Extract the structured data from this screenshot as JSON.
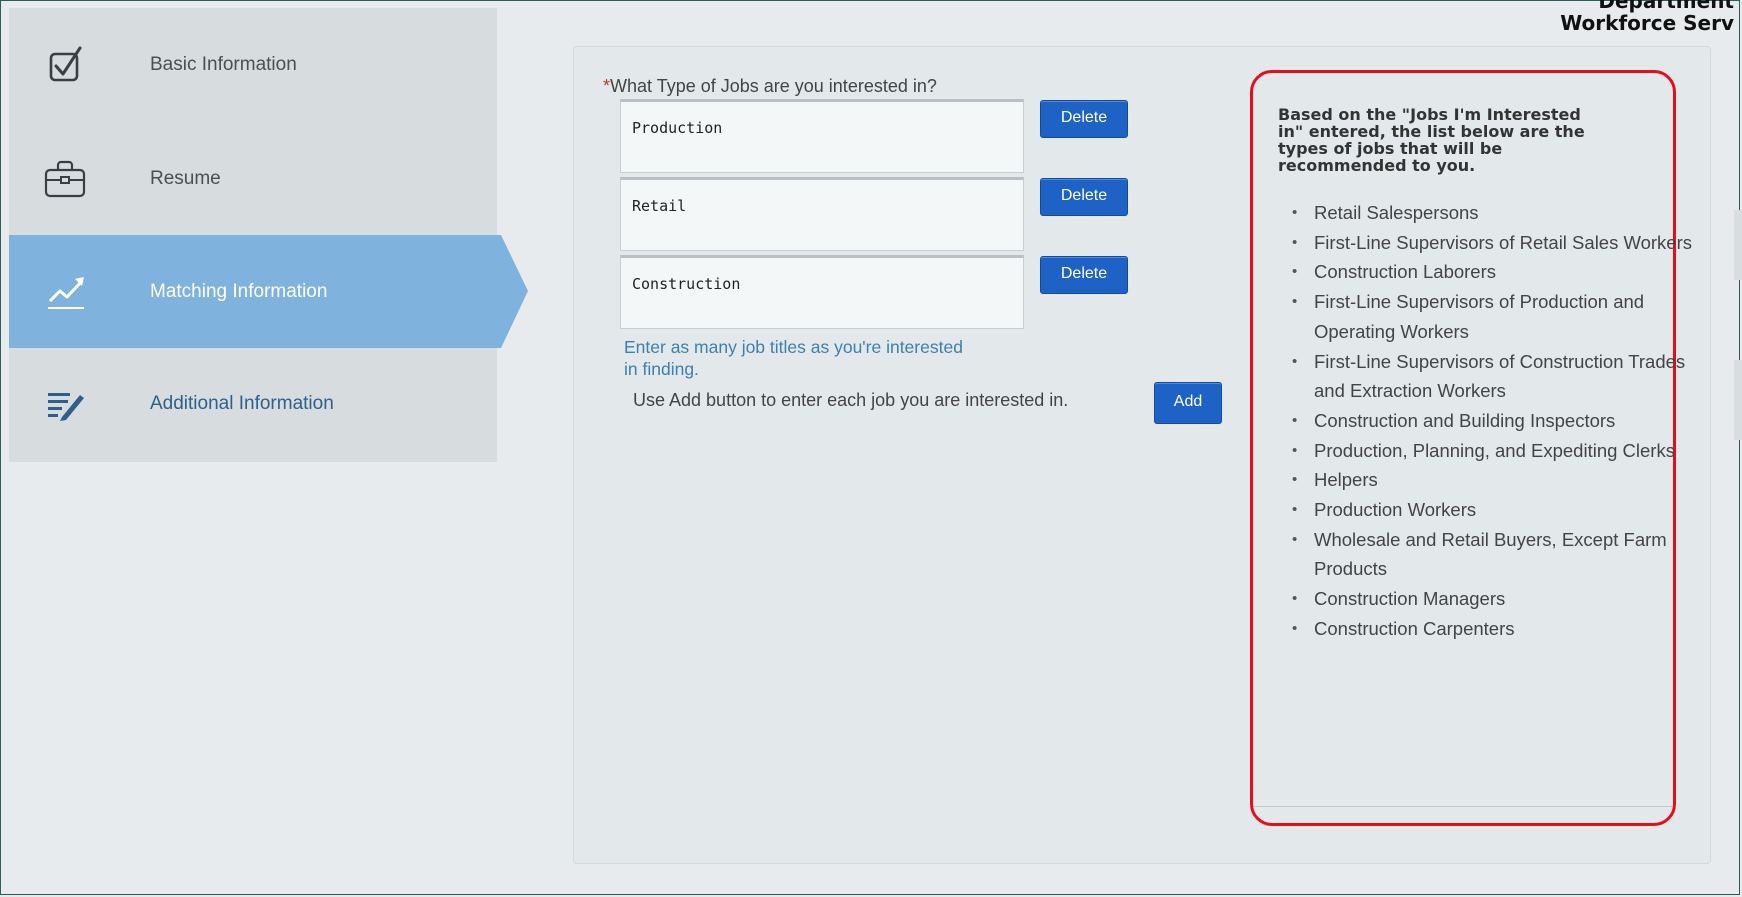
{
  "brand": {
    "line1": "Department",
    "line2": "Workforce Serv"
  },
  "sidebar": {
    "items": [
      {
        "label": "Basic Information",
        "icon": "checkbox-icon"
      },
      {
        "label": "Resume",
        "icon": "briefcase-icon"
      },
      {
        "label": "Matching Information",
        "icon": "trend-chart-icon",
        "active": true
      },
      {
        "label": "Additional Information",
        "icon": "edit-list-icon"
      }
    ],
    "active_color": "#7fb2dc"
  },
  "form": {
    "required_mark": "*",
    "question": "What Type of Jobs are you interested in?",
    "jobs": [
      "Production",
      "Retail",
      "Construction"
    ],
    "delete_label": "Delete",
    "hint": "Enter as many job titles as you're interested in finding.",
    "instruction": "Use Add button to enter each job you are interested in.",
    "add_label": "Add"
  },
  "recommendations": {
    "intro": "Based on the \"Jobs I'm Interested in\" entered, the list below are the types of jobs that will be recommended to you.",
    "items": [
      "Retail Salespersons",
      "First-Line Supervisors of Retail Sales Workers",
      "Construction Laborers",
      "First-Line Supervisors of Production and Operating Workers",
      "First-Line Supervisors of Construction Trades and Extraction Workers",
      "Construction and Building Inspectors",
      "Production, Planning, and Expediting Clerks",
      "Helpers",
      "Production Workers",
      "Wholesale and Retail Buyers, Except Farm Products",
      "Construction Managers",
      "Construction Carpenters"
    ],
    "highlight_color": "#e3101b"
  }
}
